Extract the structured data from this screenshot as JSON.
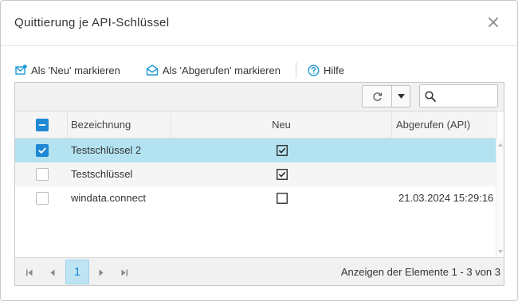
{
  "dialog": {
    "title": "Quittierung je API-Schlüssel"
  },
  "toolbar": {
    "mark_new": "Als 'Neu' markieren",
    "mark_fetched": "Als 'Abgerufen' markieren",
    "help": "Hilfe"
  },
  "search": {
    "placeholder": ""
  },
  "grid": {
    "columns": {
      "name": "Bezeichnung",
      "neu": "Neu",
      "fetched": "Abgerufen (API)"
    },
    "rows": [
      {
        "name": "Testschlüssel 2",
        "neu": true,
        "fetched": "",
        "selected": true
      },
      {
        "name": "Testschlüssel",
        "neu": true,
        "fetched": "",
        "selected": false
      },
      {
        "name": "windata.connect",
        "neu": false,
        "fetched": "21.03.2024 15:29:16",
        "selected": false
      }
    ]
  },
  "pager": {
    "current_page": "1",
    "info": "Anzeigen der Elemente 1 - 3 von 3"
  },
  "colors": {
    "accent": "#1e88d4",
    "selected_row": "#b3e2f0",
    "toolbar_icon": "#1e9ad6"
  }
}
